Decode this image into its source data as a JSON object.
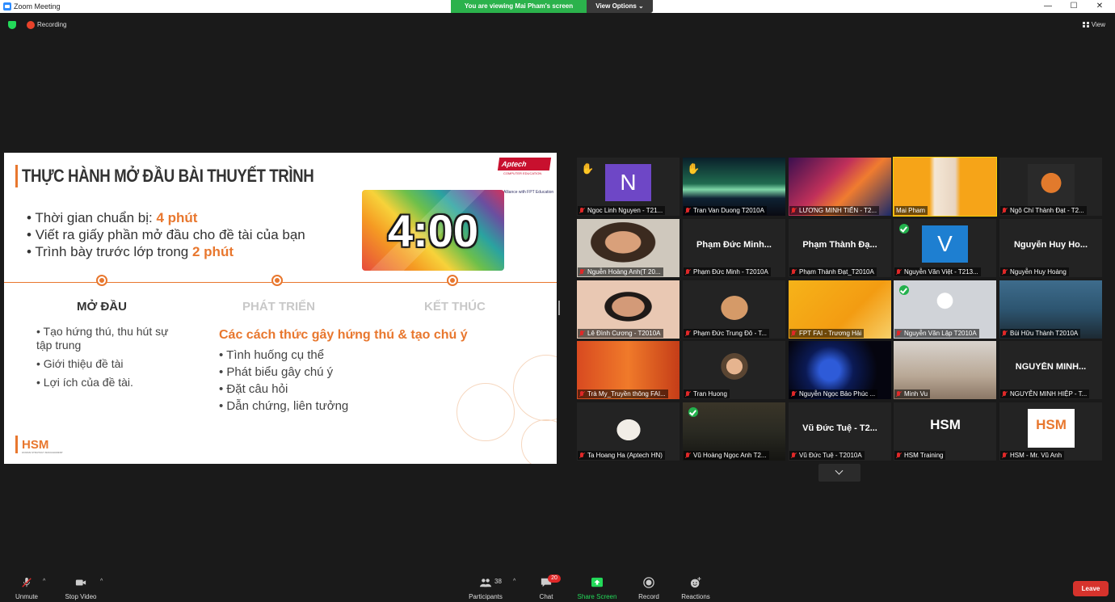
{
  "window": {
    "title": "Zoom Meeting",
    "viewing_banner": "You are viewing Mai Pham's screen",
    "view_options": "View Options",
    "minimize": "—",
    "maximize": "☐",
    "close": "✕"
  },
  "status": {
    "recording": "Recording",
    "view": "View"
  },
  "slide": {
    "heading": "THỰC HÀNH MỞ ĐẦU BÀI THUYẾT TRÌNH",
    "logo_aptech": "Aptech",
    "logo_aptech_sub": "COMPUTER EDUCATION",
    "logo_fpt": "Alliance with FPT Education",
    "timer": "4:00",
    "bullets": [
      {
        "text": "Thời gian chuẩn bị: ",
        "highlight": "4 phút"
      },
      {
        "text": "Viết ra giấy phần mở đầu cho đề tài của bạn",
        "highlight": ""
      },
      {
        "text": "Trình bày trước lớp trong ",
        "highlight": "2 phút"
      }
    ],
    "stages": [
      "MỞ ĐẦU",
      "PHÁT TRIỂN",
      "KẾT THÚC"
    ],
    "left_list": [
      "Tạo hứng thú, thu hút sự tập trung",
      "Giới thiệu đề tài",
      "Lợi ích của đề tài."
    ],
    "mid_heading": "Các cách thức gây hứng thú & tạo chú ý",
    "mid_list": [
      "Tình huống cụ thể",
      "Phát biểu gây chú ý",
      "Đặt câu hỏi",
      "Dẫn chứng, liên tưởng"
    ],
    "hsm": "HSM",
    "hsm_sub": "HUMAN STRATEGY MANAGEMENT"
  },
  "participants": [
    {
      "name": "Ngoc Linh Nguyen - T21...",
      "kind": "initial",
      "initial": "N",
      "color": "#6e47c6",
      "hand": true
    },
    {
      "name": "Tran Van Duong T2010A",
      "kind": "aurora",
      "hand": true
    },
    {
      "name": "LƯƠNG MINH TIẾN - T2...",
      "kind": "art"
    },
    {
      "name": "Mai Pham",
      "kind": "presenter",
      "active": true
    },
    {
      "name": "Ngô Chí Thành Đạt - T2...",
      "kind": "cam-orange"
    },
    {
      "name": "Nguễn Hoàng Anh(T 20...",
      "kind": "cam-face"
    },
    {
      "name": "Phạm Đức Minh - T2010A",
      "kind": "text",
      "center": "Phạm Đức Minh..."
    },
    {
      "name": "Phạm Thành Đạt_T2010A",
      "kind": "text",
      "center": "Phạm Thành Đạ..."
    },
    {
      "name": "Nguyễn Văn Việt - T213...",
      "kind": "initial",
      "initial": "V",
      "color": "#1e7fd1",
      "check": true
    },
    {
      "name": "Nguyễn Huy Hoàng",
      "kind": "text",
      "center": "Nguyễn Huy Ho..."
    },
    {
      "name": "Lê Đình Cương - T2010A",
      "kind": "cam-face2"
    },
    {
      "name": "Phạm Đức Trung Đô - T...",
      "kind": "cat"
    },
    {
      "name": "FPT FAI - Trương Hải",
      "kind": "poster"
    },
    {
      "name": "Nguyễn Văn Lập T2010A",
      "kind": "avatar",
      "check": true
    },
    {
      "name": "Bùi Hữu Thành T2010A",
      "kind": "cam-room"
    },
    {
      "name": "Trà My_Truyền thông FAI...",
      "kind": "cam-girl"
    },
    {
      "name": "Tran Huong",
      "kind": "cam-small"
    },
    {
      "name": "Nguyễn Ngọc Bảo Phúc ...",
      "kind": "dark-art"
    },
    {
      "name": "Minh Vu",
      "kind": "cam-boy"
    },
    {
      "name": "NGUYỄN MINH HIỆP - T...",
      "kind": "text",
      "center": "NGUYỄN MINH..."
    },
    {
      "name": "Ta Hoang Ha (Aptech HN)",
      "kind": "wedding"
    },
    {
      "name": "Vũ Hoàng Ngọc Anh T2...",
      "kind": "cam-dark",
      "check": true
    },
    {
      "name": "Vũ Đức Tuệ - T2010A",
      "kind": "text",
      "center": "Vũ Đức Tuệ - T2..."
    },
    {
      "name": "HSM Training",
      "kind": "hsm-dark"
    },
    {
      "name": "HSM - Mr. Vũ Anh",
      "kind": "hsm-light"
    }
  ],
  "toolbar": {
    "unmute": "Unmute",
    "stop_video": "Stop Video",
    "participants": "Participants",
    "participants_count": "38",
    "chat": "Chat",
    "chat_badge": "20",
    "share_screen": "Share Screen",
    "record": "Record",
    "reactions": "Reactions",
    "leave": "Leave"
  },
  "colors": {
    "accent_orange": "#e8772e",
    "zoom_green": "#2bb24c",
    "leave_red": "#d6332c",
    "active_yellow": "#f5d10a"
  }
}
